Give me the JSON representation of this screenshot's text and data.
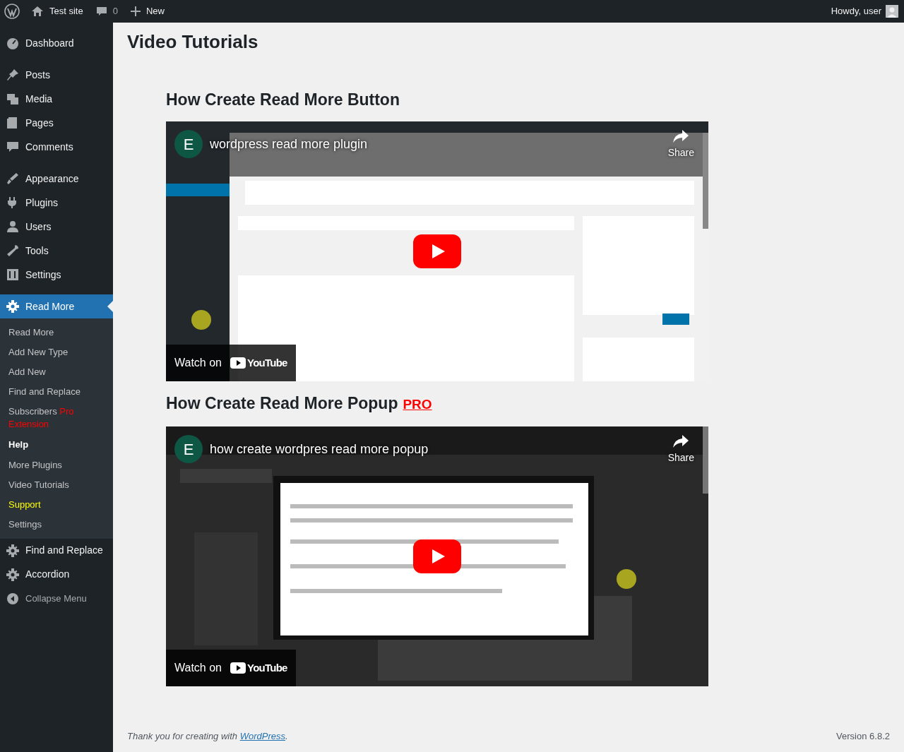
{
  "admin_bar": {
    "site": "Test site",
    "comments": "0",
    "new": "New",
    "greeting": "Howdy, user"
  },
  "sidebar": {
    "items": [
      {
        "label": "Dashboard",
        "selected": false
      },
      {
        "label": "Posts",
        "selected": false
      },
      {
        "label": "Media",
        "selected": false
      },
      {
        "label": "Pages",
        "selected": false
      },
      {
        "label": "Comments",
        "selected": false
      },
      {
        "label": "Appearance",
        "selected": false
      },
      {
        "label": "Plugins",
        "selected": false
      },
      {
        "label": "Users",
        "selected": false
      },
      {
        "label": "Tools",
        "selected": false
      },
      {
        "label": "Settings",
        "selected": false
      },
      {
        "label": "Read More",
        "selected": true,
        "children": [
          {
            "label": "Read More",
            "kind": "link"
          },
          {
            "label": "Add New Type",
            "kind": "link"
          },
          {
            "label": "Add New",
            "kind": "link"
          },
          {
            "label": "Find and Replace",
            "kind": "link"
          },
          {
            "label": "Subscribers",
            "extra": "Pro Extension",
            "kind": "link"
          },
          {
            "label": "Help",
            "kind": "heading"
          },
          {
            "label": "More Plugins",
            "kind": "link"
          },
          {
            "label": "Video Tutorials",
            "kind": "link"
          },
          {
            "label": "Support",
            "kind": "link",
            "color": "#ffff00"
          },
          {
            "label": "Settings",
            "kind": "link"
          }
        ]
      },
      {
        "label": "Find and Replace",
        "selected": false
      },
      {
        "label": "Accordion",
        "selected": false
      }
    ],
    "collapse": "Collapse Menu"
  },
  "page_title": "Video Tutorials",
  "videos": [
    {
      "heading": "How Create Read More Button",
      "avatar": "E",
      "title": "wordpress read more plugin",
      "share": "Share",
      "watch_on": "Watch on",
      "brand": "YouTube"
    },
    {
      "heading": "How Create Read More Popup",
      "pro": "PRO",
      "avatar": "E",
      "title": "how create wordpres read more popup",
      "share": "Share",
      "watch_on": "Watch on",
      "brand": "YouTube"
    }
  ],
  "footer": {
    "thanks": "Thank you for creating with ",
    "link": "WordPress",
    "end": ".",
    "version": "Version 6.8.2"
  }
}
